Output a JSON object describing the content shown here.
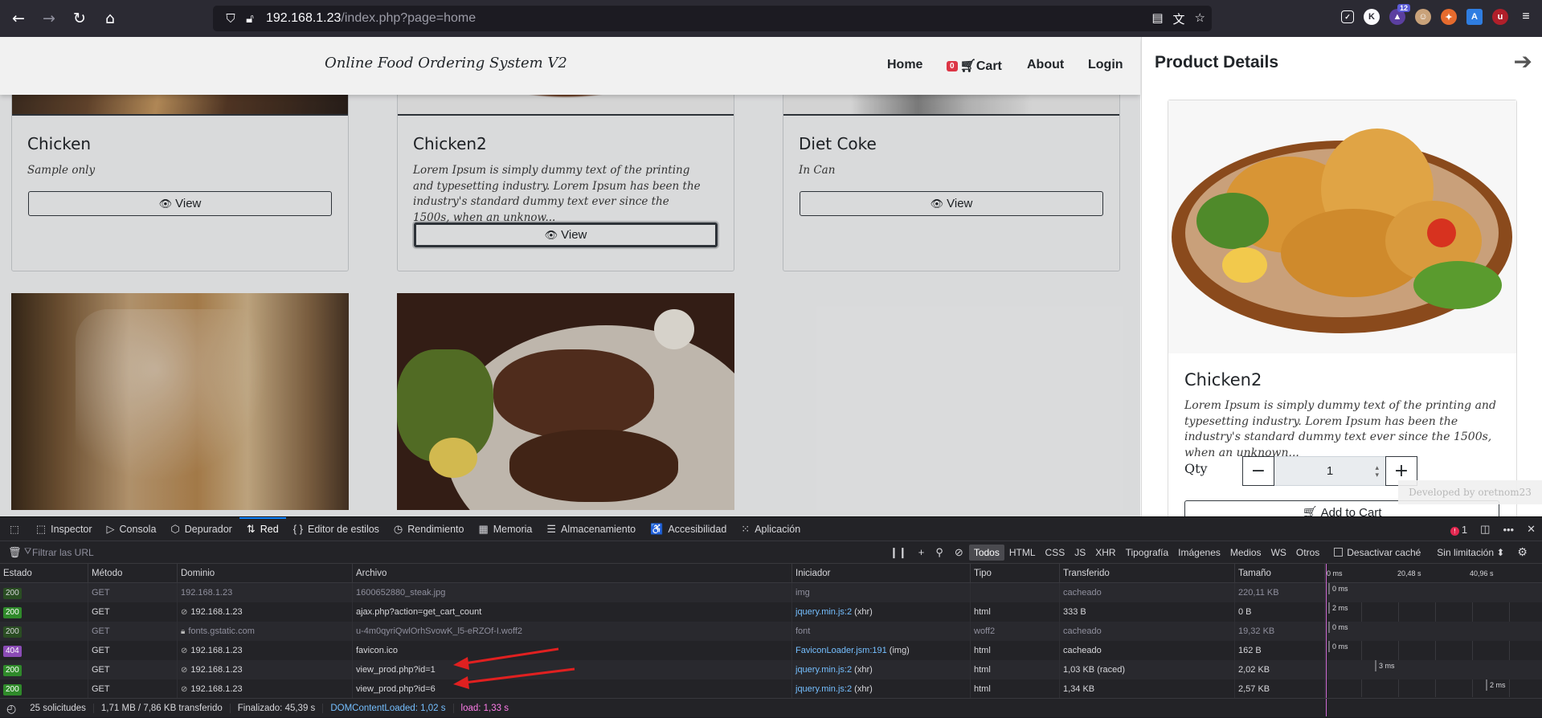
{
  "browser": {
    "url_host": "192.168.1.23",
    "url_path": "/index.php?page=home",
    "ext_badge_count": "12"
  },
  "site": {
    "brand": "Online Food Ordering System V2",
    "nav": {
      "home": "Home",
      "cart_count": "0",
      "cart": "Cart",
      "about": "About",
      "login": "Login"
    },
    "products": [
      {
        "name": "Chicken",
        "desc": "Sample only",
        "button": "View"
      },
      {
        "name": "Chicken2",
        "desc": "Lorem Ipsum is simply dummy text of the printing and typesetting industry. Lorem Ipsum has been the industry's standard dummy text ever since the 1500s, when an unknow...",
        "button": "View"
      },
      {
        "name": "Diet Coke",
        "desc": "In Can",
        "button": "View"
      }
    ]
  },
  "panel": {
    "title": "Product Details",
    "product_name": "Chicken2",
    "product_desc": "Lorem Ipsum is simply dummy text of the printing and typesetting industry. Lorem Ipsum has been the industry's standard dummy text ever since the 1500s, when an unknown...",
    "qty_label": "Qty",
    "qty_value": "1",
    "minus": "−",
    "plus": "+",
    "add_to_cart": "Add to Cart",
    "developed_by": "Developed by oretnom23"
  },
  "devtools": {
    "tabs": [
      {
        "icon": "⬚",
        "label": "Inspector"
      },
      {
        "icon": "▷",
        "label": "Consola"
      },
      {
        "icon": "⬡",
        "label": "Depurador"
      },
      {
        "icon": "⇅",
        "label": "Red"
      },
      {
        "icon": "{ }",
        "label": "Editor de estilos"
      },
      {
        "icon": "◷",
        "label": "Rendimiento"
      },
      {
        "icon": "▦",
        "label": "Memoria"
      },
      {
        "icon": "☰",
        "label": "Almacenamiento"
      },
      {
        "icon": "♿",
        "label": "Accesibilidad"
      },
      {
        "icon": "⁙",
        "label": "Aplicación"
      }
    ],
    "error_count": "1",
    "filter_placeholder": "Filtrar las URL",
    "type_filters": [
      "Todos",
      "HTML",
      "CSS",
      "JS",
      "XHR",
      "Tipografía",
      "Imágenes",
      "Medios",
      "WS",
      "Otros"
    ],
    "disable_cache": "Desactivar caché",
    "throttle": "Sin limitación ⬍",
    "columns": [
      "Estado",
      "Método",
      "Dominio",
      "Archivo",
      "Iniciador",
      "Tipo",
      "Transferido",
      "Tamaño"
    ],
    "timeline_ticks": [
      "0 ms",
      "20,48 s",
      "40,96 s"
    ],
    "requests": [
      {
        "status": "200",
        "method": "GET",
        "domain": "192.168.1.23",
        "file": "1600652880_steak.jpg",
        "initiator": "img",
        "type": "",
        "transferred": "cacheado",
        "size": "220,11 KB",
        "time": "0 ms"
      },
      {
        "status": "200",
        "method": "GET",
        "domain": "192.168.1.23",
        "file": "ajax.php?action=get_cart_count",
        "initiator": "jquery.min.js:2",
        "initiator_suffix": "(xhr)",
        "type": "html",
        "transferred": "333 B",
        "size": "0 B",
        "time": "2 ms"
      },
      {
        "status": "200",
        "method": "GET",
        "domain": "fonts.gstatic.com",
        "file": "u-4m0qyriQwlOrhSvowK_l5-eRZOf-I.woff2",
        "initiator": "font",
        "type": "woff2",
        "transferred": "cacheado",
        "size": "19,32 KB",
        "time": "0 ms"
      },
      {
        "status": "404",
        "method": "GET",
        "domain": "192.168.1.23",
        "file": "favicon.ico",
        "initiator": "FaviconLoader.jsm:191",
        "initiator_suffix": "(img)",
        "type": "html",
        "transferred": "cacheado",
        "size": "162 B",
        "time": "0 ms"
      },
      {
        "status": "200",
        "method": "GET",
        "domain": "192.168.1.23",
        "file": "view_prod.php?id=1",
        "initiator": "jquery.min.js:2",
        "initiator_suffix": "(xhr)",
        "type": "html",
        "transferred": "1,03 KB (raced)",
        "size": "2,02 KB",
        "time": "3 ms"
      },
      {
        "status": "200",
        "method": "GET",
        "domain": "192.168.1.23",
        "file": "view_prod.php?id=6",
        "initiator": "jquery.min.js:2",
        "initiator_suffix": "(xhr)",
        "type": "html",
        "transferred": "1,34 KB",
        "size": "2,57 KB",
        "time": "2 ms"
      }
    ],
    "summary": {
      "requests": "25 solicitudes",
      "transferred": "1,71 MB / 7,86 KB transferido",
      "finished": "Finalizado: 45,39 s",
      "dcl": "DOMContentLoaded: 1,02 s",
      "load": "load: 1,33 s"
    }
  }
}
